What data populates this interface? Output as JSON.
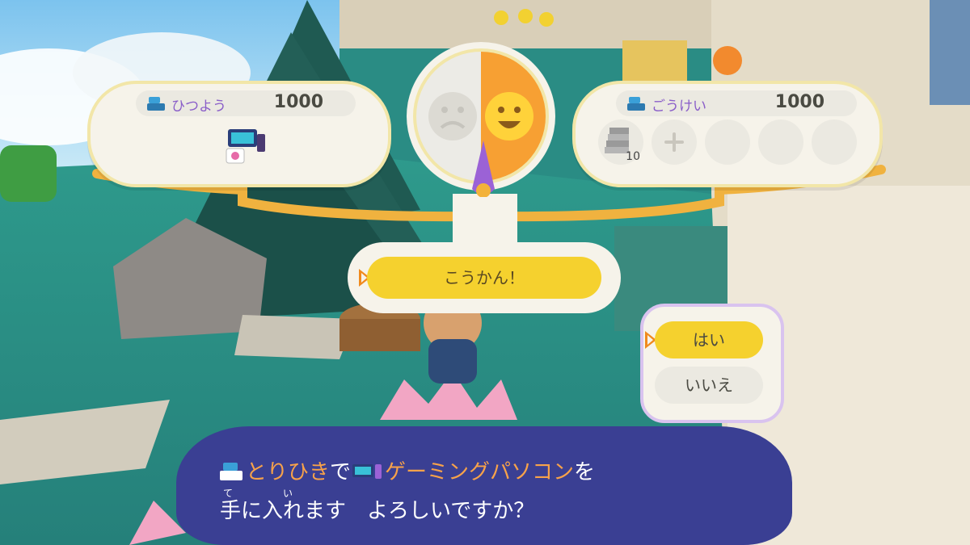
{
  "colors": {
    "accent_yellow": "#f5d12e",
    "cursor_orange": "#f08a1d",
    "label_purple": "#8a5ec9",
    "dialog_blue": "#3a3f93",
    "highlight_orange": "#f7a24a",
    "happy_orange": "#f7a033"
  },
  "required": {
    "label": "ひつよう",
    "value": "1000",
    "icon": "cash-register-icon",
    "item_icon": "gaming-pc-icon"
  },
  "total": {
    "label": "ごうけい",
    "value": "1000",
    "icon": "cash-register-icon",
    "items": [
      {
        "icon": "stone-stairs-icon",
        "qty": "10"
      },
      {
        "icon": "plus-icon"
      },
      {
        "icon": "empty-slot"
      },
      {
        "icon": "empty-slot"
      },
      {
        "icon": "empty-slot"
      }
    ]
  },
  "dial": {
    "left_face": "sad-face-icon",
    "right_face": "happy-face-icon",
    "needle": "needle-pointer-icon"
  },
  "exchange": {
    "label": "こうかん！"
  },
  "choices": {
    "yes": "はい",
    "no": "いいえ"
  },
  "dialog": {
    "line1_hl1": "とりひき",
    "line1_mid": "で",
    "line1_hl2": "ゲーミングパソコン",
    "line1_end": "を",
    "line2": "手に入れます　よろしいですか？",
    "ruby_te": "て",
    "ruby_i": "い"
  }
}
